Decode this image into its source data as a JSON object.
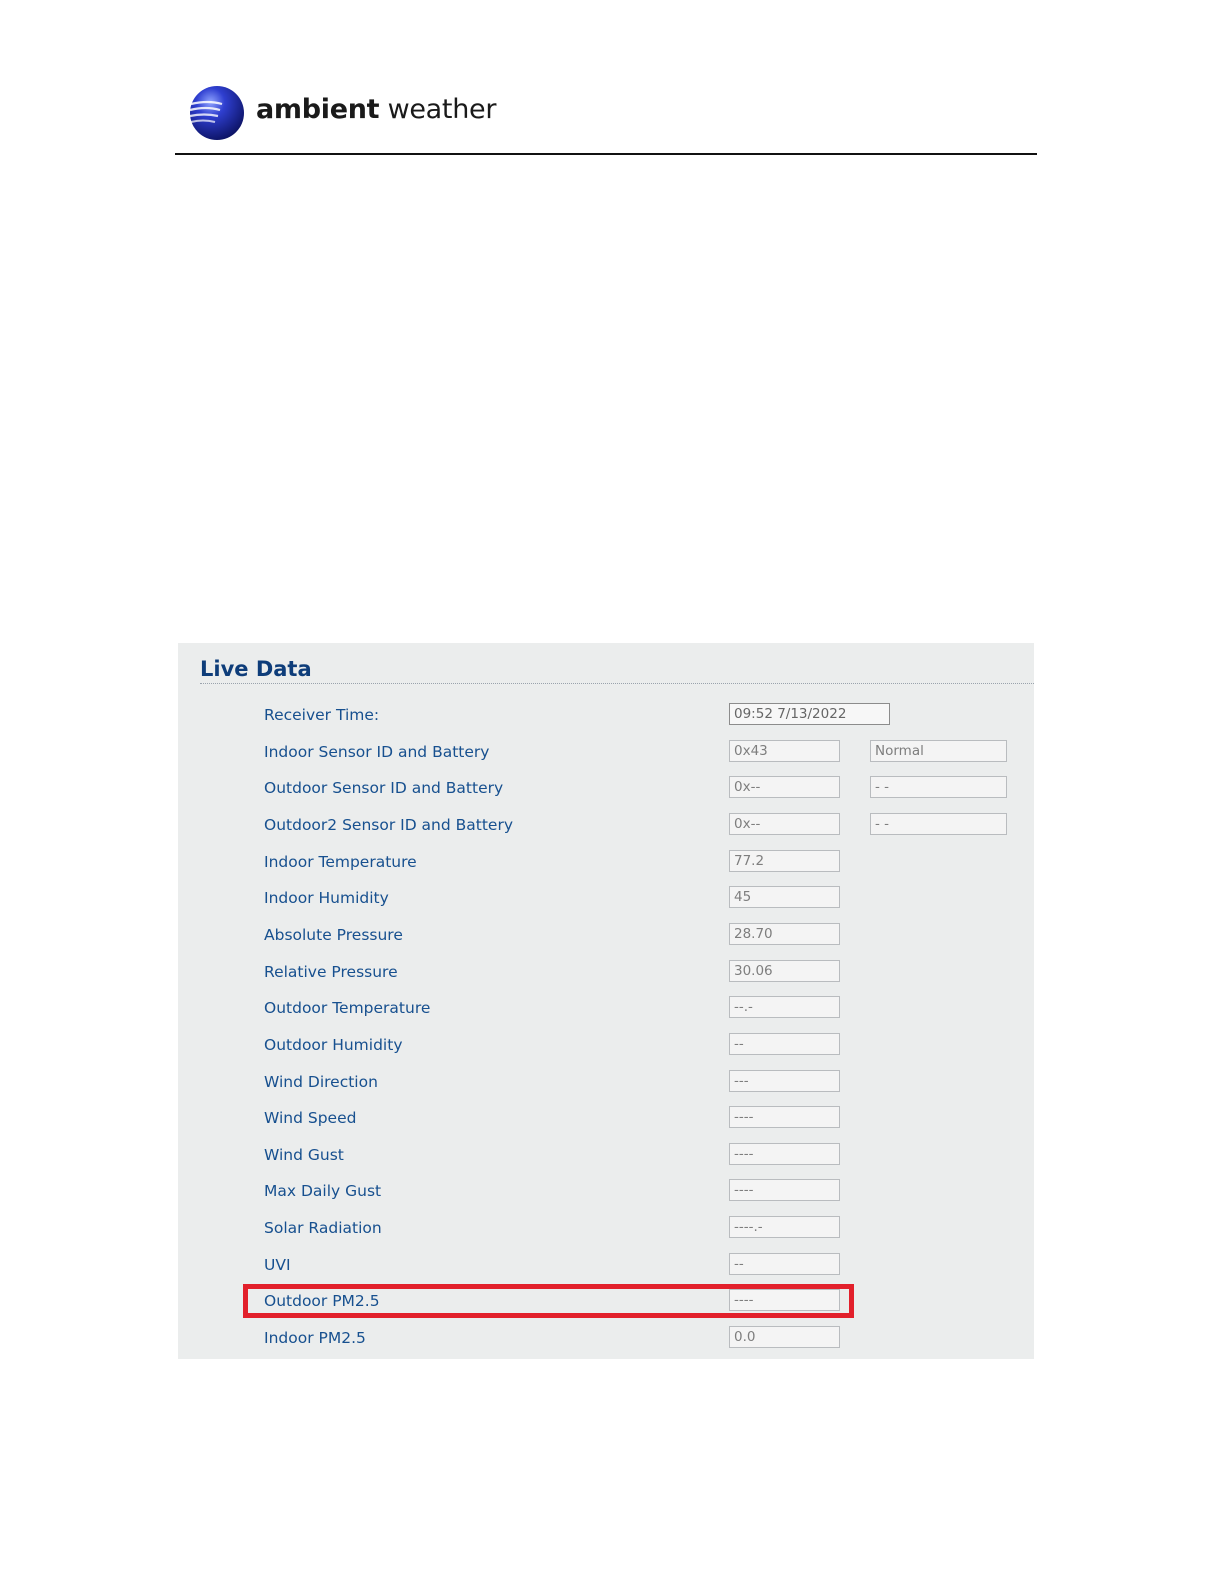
{
  "brand": {
    "logo_text_bold": "ambient",
    "logo_text_light": " weather",
    "colors": {
      "globe": "#1b2fb8",
      "rule": "#111111"
    }
  },
  "panel": {
    "title": "Live Data",
    "colors": {
      "title": "#0e3d7a",
      "label": "#17508f",
      "panel_bg": "#ebeded",
      "highlight": "#e2202b"
    },
    "rows": [
      {
        "label": "Receiver Time:",
        "value": "09:52 7/13/2022"
      },
      {
        "label": "Indoor Sensor ID and Battery",
        "value": "0x43",
        "value2": "Normal"
      },
      {
        "label": "Outdoor Sensor ID and Battery",
        "value": "0x--",
        "value2": "- -"
      },
      {
        "label": "Outdoor2 Sensor ID and Battery",
        "value": "0x--",
        "value2": "- -"
      },
      {
        "label": "Indoor Temperature",
        "value": "77.2"
      },
      {
        "label": "Indoor Humidity",
        "value": "45"
      },
      {
        "label": "Absolute Pressure",
        "value": "28.70"
      },
      {
        "label": "Relative Pressure",
        "value": "30.06"
      },
      {
        "label": "Outdoor Temperature",
        "value": "--.-"
      },
      {
        "label": "Outdoor Humidity",
        "value": "--"
      },
      {
        "label": "Wind Direction",
        "value": "---"
      },
      {
        "label": "Wind Speed",
        "value": "----"
      },
      {
        "label": "Wind Gust",
        "value": "----"
      },
      {
        "label": "Max Daily Gust",
        "value": "----"
      },
      {
        "label": "Solar Radiation",
        "value": "----.-"
      },
      {
        "label": "UVI",
        "value": "--"
      },
      {
        "label": "Outdoor PM2.5",
        "value": "----",
        "highlighted": true
      },
      {
        "label": "Indoor PM2.5",
        "value": "0.0"
      }
    ]
  }
}
